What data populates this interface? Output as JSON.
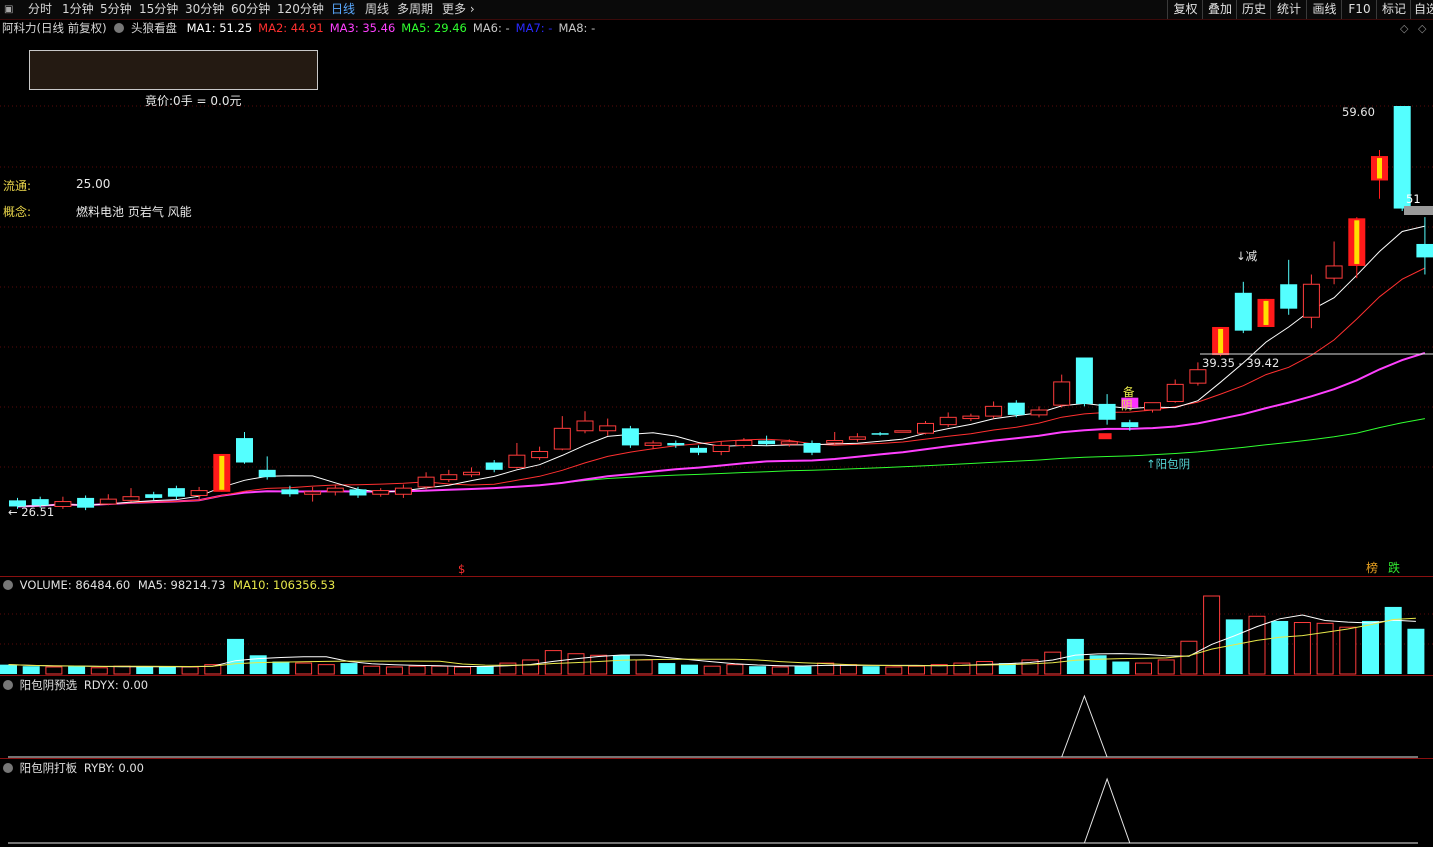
{
  "toolbar": {
    "periods": [
      "分时",
      "1分钟",
      "5分钟",
      "15分钟",
      "30分钟",
      "60分钟",
      "120分钟",
      "日线",
      "周线",
      "多周期",
      "更多"
    ],
    "active_period": "日线",
    "right_buttons": [
      "复权",
      "叠加",
      "历史",
      "统计",
      "画线",
      "F10",
      "标记",
      "自选"
    ]
  },
  "main": {
    "stock_title": "阿科力(日线 前复权)",
    "indicator_name": "头狼看盘",
    "ma": [
      {
        "label": "MA1:",
        "value": "51.25",
        "color": "#ffffff"
      },
      {
        "label": "MA2:",
        "value": "44.91",
        "color": "#ff3030"
      },
      {
        "label": "MA3:",
        "value": "35.46",
        "color": "#ff40ff"
      },
      {
        "label": "MA5:",
        "value": "29.46",
        "color": "#30ff30"
      },
      {
        "label": "MA6:",
        "value": "-",
        "color": "#c8c8c8"
      },
      {
        "label": "MA7:",
        "value": "-",
        "color": "#2a2aff"
      },
      {
        "label": "MA8:",
        "value": "-",
        "color": "#c8c8c8"
      }
    ],
    "auction_label": "竟价:",
    "auction_value": "0手 = 0.0元",
    "liutong_label": "流通:",
    "liutong_value": "25.00",
    "concept_label": "概念:",
    "concept_value": "燃料电池 页岩气 风能",
    "high_label": "59.60",
    "low_label": "26.51",
    "range_label": "39.35 - 39.42",
    "current_tag": "51",
    "annotations": {
      "jian": "↓减",
      "bei": "备",
      "yin": "阴",
      "yangbaoyin": "↑阳包阴",
      "dollar": "$",
      "bang": "榜",
      "die": "跌"
    }
  },
  "volume": {
    "label": "VOLUME:",
    "value": "86484.60",
    "ma5_label": "MA5:",
    "ma5_value": "98214.73",
    "ma10_label": "MA10:",
    "ma10_value": "106356.53"
  },
  "ind1": {
    "label": "阳包阴预选",
    "name": "RDYX:",
    "value": "0.00"
  },
  "ind2": {
    "label": "阳包阴打板",
    "name": "RYBY:",
    "value": "0.00"
  },
  "colors": {
    "up": "#ff3c3c",
    "down": "#54ffff",
    "ma1": "#ffffff",
    "ma2": "#ff3030",
    "ma3": "#ff40ff",
    "ma5": "#30ff30",
    "limit_up_outer": "#ff1a1a",
    "limit_up_inner": "#ffe000"
  },
  "chart_data": {
    "type": "candlestick",
    "price_min": 26.51,
    "price_max": 59.6,
    "candles": [
      {
        "o": 27.3,
        "c": 26.8,
        "h": 27.5,
        "l": 26.6
      },
      {
        "o": 27.4,
        "c": 26.9,
        "h": 27.6,
        "l": 26.7
      },
      {
        "o": 26.8,
        "c": 27.2,
        "h": 27.6,
        "l": 26.6
      },
      {
        "o": 27.5,
        "c": 26.7,
        "h": 27.7,
        "l": 26.5
      },
      {
        "o": 27.0,
        "c": 27.4,
        "h": 27.8,
        "l": 26.9
      },
      {
        "o": 27.3,
        "c": 27.6,
        "h": 28.3,
        "l": 27.2
      },
      {
        "o": 27.8,
        "c": 27.5,
        "h": 28.0,
        "l": 27.3
      },
      {
        "o": 28.3,
        "c": 27.6,
        "h": 28.5,
        "l": 27.4
      },
      {
        "o": 27.7,
        "c": 28.1,
        "h": 28.4,
        "l": 27.4
      },
      {
        "o": 28.0,
        "c": 31.1,
        "h": 31.1,
        "l": 28.0,
        "limit": true
      },
      {
        "o": 32.4,
        "c": 30.4,
        "h": 32.9,
        "l": 30.3
      },
      {
        "o": 29.8,
        "c": 29.2,
        "h": 30.9,
        "l": 29.0
      },
      {
        "o": 28.2,
        "c": 27.8,
        "h": 28.5,
        "l": 27.6
      },
      {
        "o": 27.8,
        "c": 28.0,
        "h": 28.4,
        "l": 27.2
      },
      {
        "o": 28.0,
        "c": 28.3,
        "h": 28.6,
        "l": 27.7
      },
      {
        "o": 28.2,
        "c": 27.7,
        "h": 28.4,
        "l": 27.5
      },
      {
        "o": 27.8,
        "c": 28.1,
        "h": 28.3,
        "l": 27.6
      },
      {
        "o": 27.8,
        "c": 28.3,
        "h": 28.6,
        "l": 27.5
      },
      {
        "o": 28.4,
        "c": 29.2,
        "h": 29.6,
        "l": 28.2
      },
      {
        "o": 29.0,
        "c": 29.4,
        "h": 29.8,
        "l": 28.8
      },
      {
        "o": 29.4,
        "c": 29.6,
        "h": 30.0,
        "l": 29.2
      },
      {
        "o": 30.4,
        "c": 29.8,
        "h": 30.6,
        "l": 29.6
      },
      {
        "o": 30.0,
        "c": 31.0,
        "h": 32.0,
        "l": 29.9
      },
      {
        "o": 30.8,
        "c": 31.3,
        "h": 31.7,
        "l": 30.6
      },
      {
        "o": 31.5,
        "c": 33.2,
        "h": 34.2,
        "l": 31.4
      },
      {
        "o": 33.0,
        "c": 33.8,
        "h": 34.6,
        "l": 32.8
      },
      {
        "o": 33.0,
        "c": 33.4,
        "h": 34.0,
        "l": 32.6
      },
      {
        "o": 33.2,
        "c": 31.8,
        "h": 33.4,
        "l": 31.6
      },
      {
        "o": 31.8,
        "c": 32.0,
        "h": 32.2,
        "l": 31.5
      },
      {
        "o": 32.0,
        "c": 31.8,
        "h": 32.2,
        "l": 31.6
      },
      {
        "o": 31.6,
        "c": 31.2,
        "h": 31.8,
        "l": 31.0
      },
      {
        "o": 31.3,
        "c": 31.8,
        "h": 32.1,
        "l": 31.0
      },
      {
        "o": 31.8,
        "c": 32.2,
        "h": 32.4,
        "l": 31.6
      },
      {
        "o": 32.2,
        "c": 31.9,
        "h": 32.6,
        "l": 31.8
      },
      {
        "o": 31.9,
        "c": 32.1,
        "h": 32.3,
        "l": 31.7
      },
      {
        "o": 32.0,
        "c": 31.2,
        "h": 32.2,
        "l": 31.0
      },
      {
        "o": 32.0,
        "c": 32.2,
        "h": 32.9,
        "l": 31.8
      },
      {
        "o": 32.3,
        "c": 32.5,
        "h": 32.8,
        "l": 32.1
      },
      {
        "o": 32.8,
        "c": 32.7,
        "h": 32.9,
        "l": 32.6
      },
      {
        "o": 33.0,
        "c": 33.0,
        "h": 33.0,
        "l": 33.0
      },
      {
        "o": 32.8,
        "c": 33.6,
        "h": 33.8,
        "l": 32.7
      },
      {
        "o": 33.5,
        "c": 34.1,
        "h": 34.5,
        "l": 33.3
      },
      {
        "o": 34.0,
        "c": 34.2,
        "h": 34.4,
        "l": 33.8
      },
      {
        "o": 34.2,
        "c": 35.0,
        "h": 35.4,
        "l": 34.0
      },
      {
        "o": 35.3,
        "c": 34.3,
        "h": 35.5,
        "l": 34.1
      },
      {
        "o": 34.3,
        "c": 34.7,
        "h": 35.0,
        "l": 34.1
      },
      {
        "o": 35.1,
        "c": 37.0,
        "h": 37.6,
        "l": 34.9
      },
      {
        "o": 39.0,
        "c": 35.2,
        "h": 39.0,
        "l": 35.0
      },
      {
        "o": 35.2,
        "c": 33.9,
        "h": 36.0,
        "l": 33.5
      },
      {
        "o": 33.7,
        "c": 33.3,
        "h": 33.9,
        "l": 33.0
      },
      {
        "o": 34.7,
        "c": 35.3,
        "h": 35.3,
        "l": 34.5
      },
      {
        "o": 35.4,
        "c": 36.8,
        "h": 37.2,
        "l": 35.3
      },
      {
        "o": 36.9,
        "c": 38.0,
        "h": 38.6,
        "l": 36.7
      },
      {
        "o": 39.2,
        "c": 41.5,
        "h": 41.5,
        "l": 39.1,
        "limit": true
      },
      {
        "o": 44.3,
        "c": 41.2,
        "h": 45.2,
        "l": 41.0
      },
      {
        "o": 41.5,
        "c": 43.8,
        "h": 43.8,
        "l": 41.5,
        "limit": true
      },
      {
        "o": 45.0,
        "c": 43.0,
        "h": 47.0,
        "l": 42.5
      },
      {
        "o": 42.3,
        "c": 45.0,
        "h": 45.8,
        "l": 41.4
      },
      {
        "o": 45.5,
        "c": 46.5,
        "h": 48.5,
        "l": 45.0
      },
      {
        "o": 46.5,
        "c": 50.4,
        "h": 50.5,
        "l": 45.5,
        "limit": true
      },
      {
        "o": 55.5,
        "c": 53.5,
        "h": 56.0,
        "l": 52.0,
        "limit": true
      },
      {
        "o": 59.6,
        "c": 51.2,
        "h": 59.6,
        "l": 51.0
      },
      {
        "o": 48.3,
        "c": 47.2,
        "h": 50.5,
        "l": 45.8
      }
    ],
    "volume": [
      12,
      10,
      9,
      10,
      8,
      10,
      10,
      9,
      9,
      12,
      45,
      24,
      16,
      14,
      12,
      14,
      10,
      9,
      10,
      10,
      9,
      10,
      14,
      18,
      30,
      26,
      24,
      24,
      18,
      14,
      12,
      10,
      12,
      10,
      9,
      10,
      14,
      12,
      10,
      9,
      10,
      12,
      14,
      16,
      14,
      18,
      28,
      45,
      24,
      16,
      14,
      18,
      42,
      100,
      70,
      74,
      68,
      66,
      65,
      60,
      68,
      86,
      58
    ],
    "rdyx_peak_index": 47,
    "ryby_peak_index": 48
  }
}
